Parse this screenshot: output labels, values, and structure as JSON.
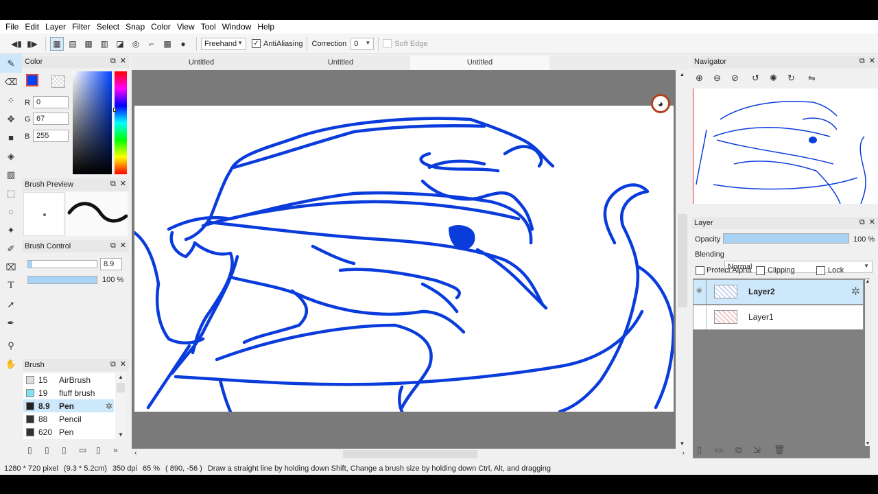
{
  "menu": [
    "File",
    "Edit",
    "Layer",
    "Filter",
    "Select",
    "Snap",
    "Color",
    "View",
    "Tool",
    "Window",
    "Help"
  ],
  "toolbar": {
    "stroke_mode": "Freehand",
    "antialiasing_label": "AntiAliasing",
    "antialiasing_checked": true,
    "correction_label": "Correction",
    "correction_value": "0",
    "soft_edge_label": "Soft Edge"
  },
  "tabs": [
    "Untitled",
    "Untitled",
    "Untitled"
  ],
  "color_panel": {
    "title": "Color",
    "r_label": "R",
    "g_label": "G",
    "b_label": "B",
    "r": "0",
    "g": "67",
    "b": "255",
    "current_color": "#0043ff"
  },
  "brush_preview": {
    "title": "Brush Preview"
  },
  "brush_control": {
    "title": "Brush Control",
    "size": "8.9",
    "opacity": "100 %",
    "size_fraction": 0.06,
    "opacity_fraction": 1.0
  },
  "brush_panel": {
    "title": "Brush",
    "items": [
      {
        "size": "15",
        "name": "AirBrush",
        "color": "#dddddd",
        "selected": false
      },
      {
        "size": "19",
        "name": "fluff brush",
        "color": "#80e0f0",
        "selected": false
      },
      {
        "size": "8.9",
        "name": "Pen",
        "color": "#222222",
        "selected": true
      },
      {
        "size": "88",
        "name": "Pencil",
        "color": "#333333",
        "selected": false
      },
      {
        "size": "620",
        "name": "Pen",
        "color": "#333333",
        "selected": false
      }
    ]
  },
  "navigator": {
    "title": "Navigator"
  },
  "layer_panel": {
    "title": "Layer",
    "opacity_label": "Opacity",
    "opacity_value": "100 %",
    "opacity_fraction": 1.0,
    "blending_label": "Blending",
    "blending_value": "Normal",
    "protect_alpha": "Protect Alpha",
    "clipping": "Clipping",
    "lock": "Lock",
    "layers": [
      {
        "name": "Layer2",
        "selected": true
      },
      {
        "name": "Layer1",
        "selected": false
      }
    ]
  },
  "status": {
    "size": "1280 * 720 pixel",
    "physical": "(9.3 * 5.2cm)",
    "dpi": "350 dpi",
    "zoom": "65 %",
    "coords": "( 890, -56 )",
    "hint": "Draw a straight line by holding down Shift, Change a brush size by holding down Ctrl, Alt, and dragging"
  },
  "colors": {
    "stroke": "#0a3cdc",
    "accent": "#0043ff",
    "selection": "#cde8fb"
  }
}
